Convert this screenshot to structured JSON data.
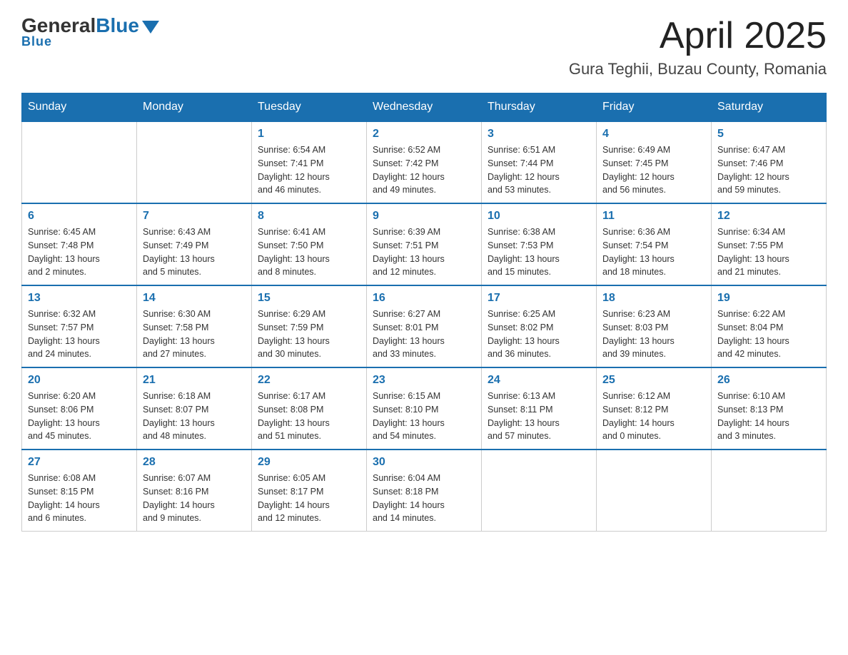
{
  "header": {
    "logo": {
      "general": "General",
      "blue": "Blue"
    },
    "title": "April 2025",
    "location": "Gura Teghii, Buzau County, Romania"
  },
  "calendar": {
    "days_of_week": [
      "Sunday",
      "Monday",
      "Tuesday",
      "Wednesday",
      "Thursday",
      "Friday",
      "Saturday"
    ],
    "weeks": [
      [
        {
          "day": "",
          "info": ""
        },
        {
          "day": "",
          "info": ""
        },
        {
          "day": "1",
          "info": "Sunrise: 6:54 AM\nSunset: 7:41 PM\nDaylight: 12 hours\nand 46 minutes."
        },
        {
          "day": "2",
          "info": "Sunrise: 6:52 AM\nSunset: 7:42 PM\nDaylight: 12 hours\nand 49 minutes."
        },
        {
          "day": "3",
          "info": "Sunrise: 6:51 AM\nSunset: 7:44 PM\nDaylight: 12 hours\nand 53 minutes."
        },
        {
          "day": "4",
          "info": "Sunrise: 6:49 AM\nSunset: 7:45 PM\nDaylight: 12 hours\nand 56 minutes."
        },
        {
          "day": "5",
          "info": "Sunrise: 6:47 AM\nSunset: 7:46 PM\nDaylight: 12 hours\nand 59 minutes."
        }
      ],
      [
        {
          "day": "6",
          "info": "Sunrise: 6:45 AM\nSunset: 7:48 PM\nDaylight: 13 hours\nand 2 minutes."
        },
        {
          "day": "7",
          "info": "Sunrise: 6:43 AM\nSunset: 7:49 PM\nDaylight: 13 hours\nand 5 minutes."
        },
        {
          "day": "8",
          "info": "Sunrise: 6:41 AM\nSunset: 7:50 PM\nDaylight: 13 hours\nand 8 minutes."
        },
        {
          "day": "9",
          "info": "Sunrise: 6:39 AM\nSunset: 7:51 PM\nDaylight: 13 hours\nand 12 minutes."
        },
        {
          "day": "10",
          "info": "Sunrise: 6:38 AM\nSunset: 7:53 PM\nDaylight: 13 hours\nand 15 minutes."
        },
        {
          "day": "11",
          "info": "Sunrise: 6:36 AM\nSunset: 7:54 PM\nDaylight: 13 hours\nand 18 minutes."
        },
        {
          "day": "12",
          "info": "Sunrise: 6:34 AM\nSunset: 7:55 PM\nDaylight: 13 hours\nand 21 minutes."
        }
      ],
      [
        {
          "day": "13",
          "info": "Sunrise: 6:32 AM\nSunset: 7:57 PM\nDaylight: 13 hours\nand 24 minutes."
        },
        {
          "day": "14",
          "info": "Sunrise: 6:30 AM\nSunset: 7:58 PM\nDaylight: 13 hours\nand 27 minutes."
        },
        {
          "day": "15",
          "info": "Sunrise: 6:29 AM\nSunset: 7:59 PM\nDaylight: 13 hours\nand 30 minutes."
        },
        {
          "day": "16",
          "info": "Sunrise: 6:27 AM\nSunset: 8:01 PM\nDaylight: 13 hours\nand 33 minutes."
        },
        {
          "day": "17",
          "info": "Sunrise: 6:25 AM\nSunset: 8:02 PM\nDaylight: 13 hours\nand 36 minutes."
        },
        {
          "day": "18",
          "info": "Sunrise: 6:23 AM\nSunset: 8:03 PM\nDaylight: 13 hours\nand 39 minutes."
        },
        {
          "day": "19",
          "info": "Sunrise: 6:22 AM\nSunset: 8:04 PM\nDaylight: 13 hours\nand 42 minutes."
        }
      ],
      [
        {
          "day": "20",
          "info": "Sunrise: 6:20 AM\nSunset: 8:06 PM\nDaylight: 13 hours\nand 45 minutes."
        },
        {
          "day": "21",
          "info": "Sunrise: 6:18 AM\nSunset: 8:07 PM\nDaylight: 13 hours\nand 48 minutes."
        },
        {
          "day": "22",
          "info": "Sunrise: 6:17 AM\nSunset: 8:08 PM\nDaylight: 13 hours\nand 51 minutes."
        },
        {
          "day": "23",
          "info": "Sunrise: 6:15 AM\nSunset: 8:10 PM\nDaylight: 13 hours\nand 54 minutes."
        },
        {
          "day": "24",
          "info": "Sunrise: 6:13 AM\nSunset: 8:11 PM\nDaylight: 13 hours\nand 57 minutes."
        },
        {
          "day": "25",
          "info": "Sunrise: 6:12 AM\nSunset: 8:12 PM\nDaylight: 14 hours\nand 0 minutes."
        },
        {
          "day": "26",
          "info": "Sunrise: 6:10 AM\nSunset: 8:13 PM\nDaylight: 14 hours\nand 3 minutes."
        }
      ],
      [
        {
          "day": "27",
          "info": "Sunrise: 6:08 AM\nSunset: 8:15 PM\nDaylight: 14 hours\nand 6 minutes."
        },
        {
          "day": "28",
          "info": "Sunrise: 6:07 AM\nSunset: 8:16 PM\nDaylight: 14 hours\nand 9 minutes."
        },
        {
          "day": "29",
          "info": "Sunrise: 6:05 AM\nSunset: 8:17 PM\nDaylight: 14 hours\nand 12 minutes."
        },
        {
          "day": "30",
          "info": "Sunrise: 6:04 AM\nSunset: 8:18 PM\nDaylight: 14 hours\nand 14 minutes."
        },
        {
          "day": "",
          "info": ""
        },
        {
          "day": "",
          "info": ""
        },
        {
          "day": "",
          "info": ""
        }
      ]
    ]
  }
}
